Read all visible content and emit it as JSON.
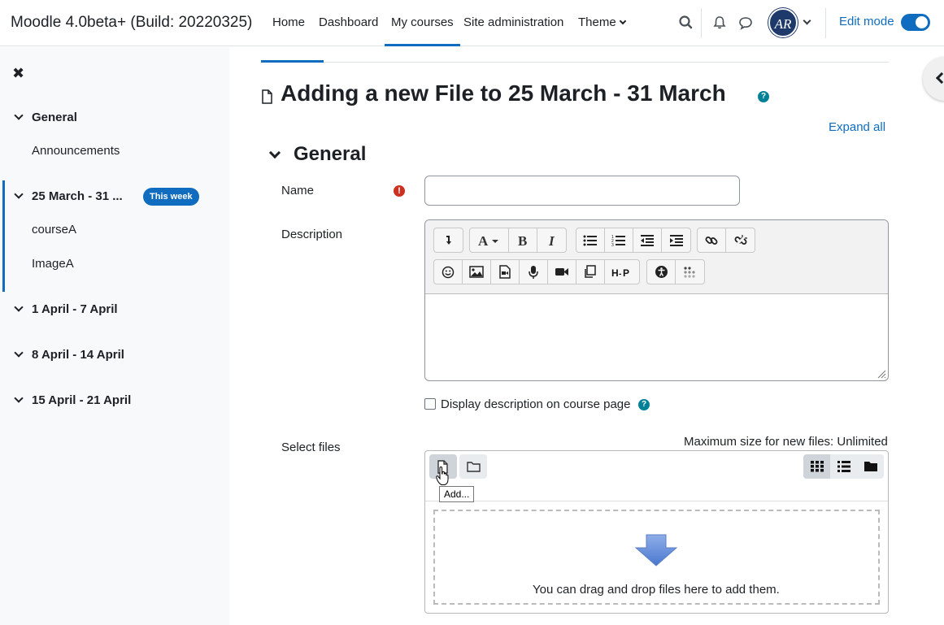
{
  "navbar": {
    "brand": "Moodle 4.0beta+ (Build: 20220325)",
    "links": [
      "Home",
      "Dashboard",
      "My courses",
      "Site administration",
      "Theme"
    ],
    "active_link": "My courses",
    "avatar_initials": "AR",
    "edit_mode_label": "Edit mode",
    "edit_mode_on": true
  },
  "drawer": {
    "sections": [
      {
        "label": "General",
        "activities": [
          "Announcements"
        ]
      },
      {
        "label": "25 March - 31 ...",
        "badge": "This week",
        "activities": [
          "courseA",
          "ImageA"
        ]
      },
      {
        "label": "1 April - 7 April",
        "activities": []
      },
      {
        "label": "8 April - 14 April",
        "activities": []
      },
      {
        "label": "15 April - 21 April",
        "activities": []
      }
    ]
  },
  "page": {
    "title": "Adding a new File to 25 March - 31 March",
    "expand_all": "Expand all",
    "fieldset_title": "General"
  },
  "form": {
    "name_label": "Name",
    "name_value": "",
    "description_label": "Description",
    "display_description_label": "Display description on course page",
    "display_description_checked": false,
    "select_files_label": "Select files",
    "max_size": "Maximum size for new files: Unlimited",
    "add_tooltip": "Add...",
    "drop_text": "You can drag and drop files here to add them."
  },
  "colors": {
    "primary": "#0f6cbf",
    "required": "#ca3120",
    "help": "#008196",
    "drawer_bg": "#f8f9fa"
  }
}
